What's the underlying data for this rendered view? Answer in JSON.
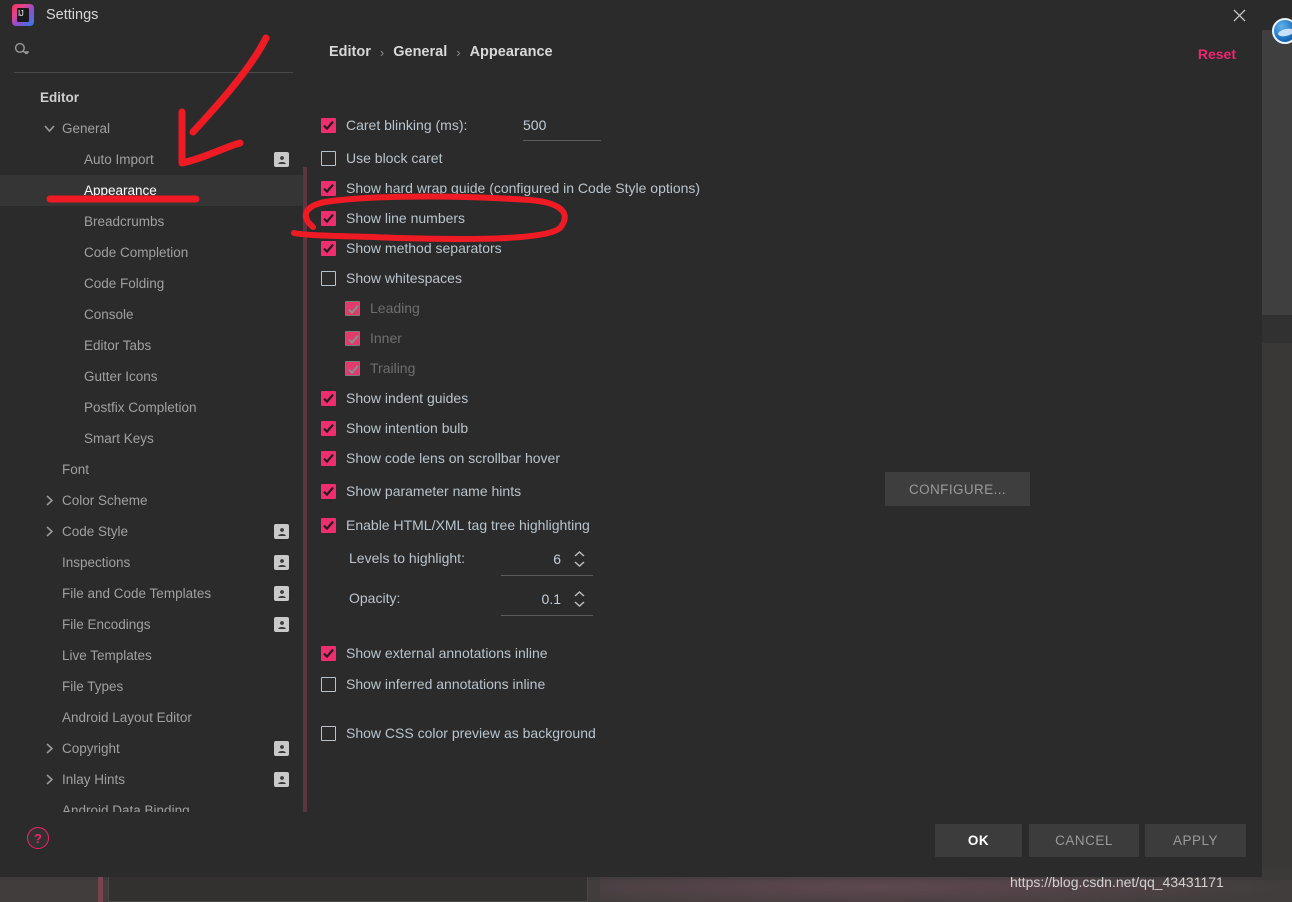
{
  "window": {
    "title": "Settings",
    "logo_icon": "intellij-idea-logo",
    "close_icon": "close-icon"
  },
  "sidebar": {
    "search": {
      "placeholder": "",
      "value": "",
      "icon": "search-icon"
    },
    "items": [
      {
        "label": "Editor",
        "level": 0,
        "chevron": "none",
        "person_icon": false,
        "selected": false
      },
      {
        "label": "General",
        "level": 1,
        "chevron": "down",
        "person_icon": false,
        "selected": false
      },
      {
        "label": "Auto Import",
        "level": 2,
        "chevron": "none",
        "person_icon": true,
        "selected": false
      },
      {
        "label": "Appearance",
        "level": 2,
        "chevron": "none",
        "person_icon": false,
        "selected": true
      },
      {
        "label": "Breadcrumbs",
        "level": 2,
        "chevron": "none",
        "person_icon": false,
        "selected": false
      },
      {
        "label": "Code Completion",
        "level": 2,
        "chevron": "none",
        "person_icon": false,
        "selected": false
      },
      {
        "label": "Code Folding",
        "level": 2,
        "chevron": "none",
        "person_icon": false,
        "selected": false
      },
      {
        "label": "Console",
        "level": 2,
        "chevron": "none",
        "person_icon": false,
        "selected": false
      },
      {
        "label": "Editor Tabs",
        "level": 2,
        "chevron": "none",
        "person_icon": false,
        "selected": false
      },
      {
        "label": "Gutter Icons",
        "level": 2,
        "chevron": "none",
        "person_icon": false,
        "selected": false
      },
      {
        "label": "Postfix Completion",
        "level": 2,
        "chevron": "none",
        "person_icon": false,
        "selected": false
      },
      {
        "label": "Smart Keys",
        "level": 2,
        "chevron": "none",
        "person_icon": false,
        "selected": false
      },
      {
        "label": "Font",
        "level": 1,
        "chevron": "none",
        "person_icon": false,
        "selected": false
      },
      {
        "label": "Color Scheme",
        "level": 1,
        "chevron": "right",
        "person_icon": false,
        "selected": false
      },
      {
        "label": "Code Style",
        "level": 1,
        "chevron": "right",
        "person_icon": true,
        "selected": false
      },
      {
        "label": "Inspections",
        "level": 1,
        "chevron": "none",
        "person_icon": true,
        "selected": false
      },
      {
        "label": "File and Code Templates",
        "level": 1,
        "chevron": "none",
        "person_icon": true,
        "selected": false
      },
      {
        "label": "File Encodings",
        "level": 1,
        "chevron": "none",
        "person_icon": true,
        "selected": false
      },
      {
        "label": "Live Templates",
        "level": 1,
        "chevron": "none",
        "person_icon": false,
        "selected": false
      },
      {
        "label": "File Types",
        "level": 1,
        "chevron": "none",
        "person_icon": false,
        "selected": false
      },
      {
        "label": "Android Layout Editor",
        "level": 1,
        "chevron": "none",
        "person_icon": false,
        "selected": false
      },
      {
        "label": "Copyright",
        "level": 1,
        "chevron": "right",
        "person_icon": true,
        "selected": false
      },
      {
        "label": "Inlay Hints",
        "level": 1,
        "chevron": "right",
        "person_icon": true,
        "selected": false
      },
      {
        "label": "Android Data Binding",
        "level": 1,
        "chevron": "none",
        "person_icon": false,
        "selected": false
      }
    ]
  },
  "main": {
    "breadcrumb": {
      "part1": "Editor",
      "part2": "General",
      "part3": "Appearance",
      "separator": "›"
    },
    "reset_label": "Reset",
    "caret_blinking": {
      "label": "Caret blinking (ms):",
      "checked": true,
      "value": "500"
    },
    "options": [
      {
        "label": "Use block caret",
        "checked": false,
        "disabled": false
      },
      {
        "label": "Show hard wrap guide (configured in Code Style options)",
        "checked": true,
        "disabled": false
      },
      {
        "label": "Show line numbers",
        "checked": true,
        "disabled": false
      },
      {
        "label": "Show method separators",
        "checked": true,
        "disabled": false
      },
      {
        "label": "Show whitespaces",
        "checked": false,
        "disabled": false
      },
      {
        "label": "Leading",
        "checked": true,
        "disabled": true
      },
      {
        "label": "Inner",
        "checked": true,
        "disabled": true
      },
      {
        "label": "Trailing",
        "checked": true,
        "disabled": true
      },
      {
        "label": "Show indent guides",
        "checked": true,
        "disabled": false
      },
      {
        "label": "Show intention bulb",
        "checked": true,
        "disabled": false
      },
      {
        "label": "Show code lens on scrollbar hover",
        "checked": true,
        "disabled": false
      },
      {
        "label": "Show parameter name hints",
        "checked": true,
        "disabled": false
      },
      {
        "label": "Enable HTML/XML tag tree highlighting",
        "checked": true,
        "disabled": false
      }
    ],
    "configure_button": "CONFIGURE...",
    "levels_to_highlight": {
      "label": "Levels to highlight:",
      "value": "6"
    },
    "opacity": {
      "label": "Opacity:",
      "value": "0.1"
    },
    "tail_options": [
      {
        "label": "Show external annotations inline",
        "checked": true
      },
      {
        "label": "Show inferred annotations inline",
        "checked": false
      },
      {
        "label": "Show CSS color preview as background",
        "checked": false
      }
    ]
  },
  "footer": {
    "help_icon": "help-question-icon",
    "help_label": "?",
    "ok_label": "OK",
    "cancel_label": "CANCEL",
    "apply_label": "APPLY"
  },
  "watermark": {
    "text": "https://blog.csdn.net/qq_43431171"
  },
  "annotations": {
    "color": "#ee1b24",
    "arrow_to_appearance": "red-arrow-annotation",
    "underline_appearance": "red-underline-annotation",
    "ellipse_method_separators": "red-ellipse-annotation"
  },
  "colors": {
    "accent_pink": "#ef2d6f",
    "dialog_bg": "#2b2b2b",
    "selected_row": "#353535",
    "annotation_red": "#ee1b24"
  }
}
